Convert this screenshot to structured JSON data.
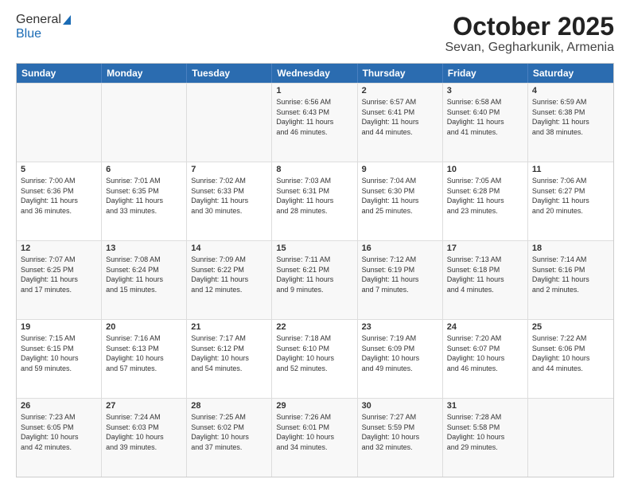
{
  "header": {
    "logo": {
      "general": "General",
      "blue": "Blue"
    },
    "title": "October 2025",
    "location": "Sevan, Gegharkunik, Armenia"
  },
  "weekdays": [
    "Sunday",
    "Monday",
    "Tuesday",
    "Wednesday",
    "Thursday",
    "Friday",
    "Saturday"
  ],
  "weeks": [
    [
      {
        "day": "",
        "detail": ""
      },
      {
        "day": "",
        "detail": ""
      },
      {
        "day": "",
        "detail": ""
      },
      {
        "day": "1",
        "detail": "Sunrise: 6:56 AM\nSunset: 6:43 PM\nDaylight: 11 hours\nand 46 minutes."
      },
      {
        "day": "2",
        "detail": "Sunrise: 6:57 AM\nSunset: 6:41 PM\nDaylight: 11 hours\nand 44 minutes."
      },
      {
        "day": "3",
        "detail": "Sunrise: 6:58 AM\nSunset: 6:40 PM\nDaylight: 11 hours\nand 41 minutes."
      },
      {
        "day": "4",
        "detail": "Sunrise: 6:59 AM\nSunset: 6:38 PM\nDaylight: 11 hours\nand 38 minutes."
      }
    ],
    [
      {
        "day": "5",
        "detail": "Sunrise: 7:00 AM\nSunset: 6:36 PM\nDaylight: 11 hours\nand 36 minutes."
      },
      {
        "day": "6",
        "detail": "Sunrise: 7:01 AM\nSunset: 6:35 PM\nDaylight: 11 hours\nand 33 minutes."
      },
      {
        "day": "7",
        "detail": "Sunrise: 7:02 AM\nSunset: 6:33 PM\nDaylight: 11 hours\nand 30 minutes."
      },
      {
        "day": "8",
        "detail": "Sunrise: 7:03 AM\nSunset: 6:31 PM\nDaylight: 11 hours\nand 28 minutes."
      },
      {
        "day": "9",
        "detail": "Sunrise: 7:04 AM\nSunset: 6:30 PM\nDaylight: 11 hours\nand 25 minutes."
      },
      {
        "day": "10",
        "detail": "Sunrise: 7:05 AM\nSunset: 6:28 PM\nDaylight: 11 hours\nand 23 minutes."
      },
      {
        "day": "11",
        "detail": "Sunrise: 7:06 AM\nSunset: 6:27 PM\nDaylight: 11 hours\nand 20 minutes."
      }
    ],
    [
      {
        "day": "12",
        "detail": "Sunrise: 7:07 AM\nSunset: 6:25 PM\nDaylight: 11 hours\nand 17 minutes."
      },
      {
        "day": "13",
        "detail": "Sunrise: 7:08 AM\nSunset: 6:24 PM\nDaylight: 11 hours\nand 15 minutes."
      },
      {
        "day": "14",
        "detail": "Sunrise: 7:09 AM\nSunset: 6:22 PM\nDaylight: 11 hours\nand 12 minutes."
      },
      {
        "day": "15",
        "detail": "Sunrise: 7:11 AM\nSunset: 6:21 PM\nDaylight: 11 hours\nand 9 minutes."
      },
      {
        "day": "16",
        "detail": "Sunrise: 7:12 AM\nSunset: 6:19 PM\nDaylight: 11 hours\nand 7 minutes."
      },
      {
        "day": "17",
        "detail": "Sunrise: 7:13 AM\nSunset: 6:18 PM\nDaylight: 11 hours\nand 4 minutes."
      },
      {
        "day": "18",
        "detail": "Sunrise: 7:14 AM\nSunset: 6:16 PM\nDaylight: 11 hours\nand 2 minutes."
      }
    ],
    [
      {
        "day": "19",
        "detail": "Sunrise: 7:15 AM\nSunset: 6:15 PM\nDaylight: 10 hours\nand 59 minutes."
      },
      {
        "day": "20",
        "detail": "Sunrise: 7:16 AM\nSunset: 6:13 PM\nDaylight: 10 hours\nand 57 minutes."
      },
      {
        "day": "21",
        "detail": "Sunrise: 7:17 AM\nSunset: 6:12 PM\nDaylight: 10 hours\nand 54 minutes."
      },
      {
        "day": "22",
        "detail": "Sunrise: 7:18 AM\nSunset: 6:10 PM\nDaylight: 10 hours\nand 52 minutes."
      },
      {
        "day": "23",
        "detail": "Sunrise: 7:19 AM\nSunset: 6:09 PM\nDaylight: 10 hours\nand 49 minutes."
      },
      {
        "day": "24",
        "detail": "Sunrise: 7:20 AM\nSunset: 6:07 PM\nDaylight: 10 hours\nand 46 minutes."
      },
      {
        "day": "25",
        "detail": "Sunrise: 7:22 AM\nSunset: 6:06 PM\nDaylight: 10 hours\nand 44 minutes."
      }
    ],
    [
      {
        "day": "26",
        "detail": "Sunrise: 7:23 AM\nSunset: 6:05 PM\nDaylight: 10 hours\nand 42 minutes."
      },
      {
        "day": "27",
        "detail": "Sunrise: 7:24 AM\nSunset: 6:03 PM\nDaylight: 10 hours\nand 39 minutes."
      },
      {
        "day": "28",
        "detail": "Sunrise: 7:25 AM\nSunset: 6:02 PM\nDaylight: 10 hours\nand 37 minutes."
      },
      {
        "day": "29",
        "detail": "Sunrise: 7:26 AM\nSunset: 6:01 PM\nDaylight: 10 hours\nand 34 minutes."
      },
      {
        "day": "30",
        "detail": "Sunrise: 7:27 AM\nSunset: 5:59 PM\nDaylight: 10 hours\nand 32 minutes."
      },
      {
        "day": "31",
        "detail": "Sunrise: 7:28 AM\nSunset: 5:58 PM\nDaylight: 10 hours\nand 29 minutes."
      },
      {
        "day": "",
        "detail": ""
      }
    ]
  ]
}
